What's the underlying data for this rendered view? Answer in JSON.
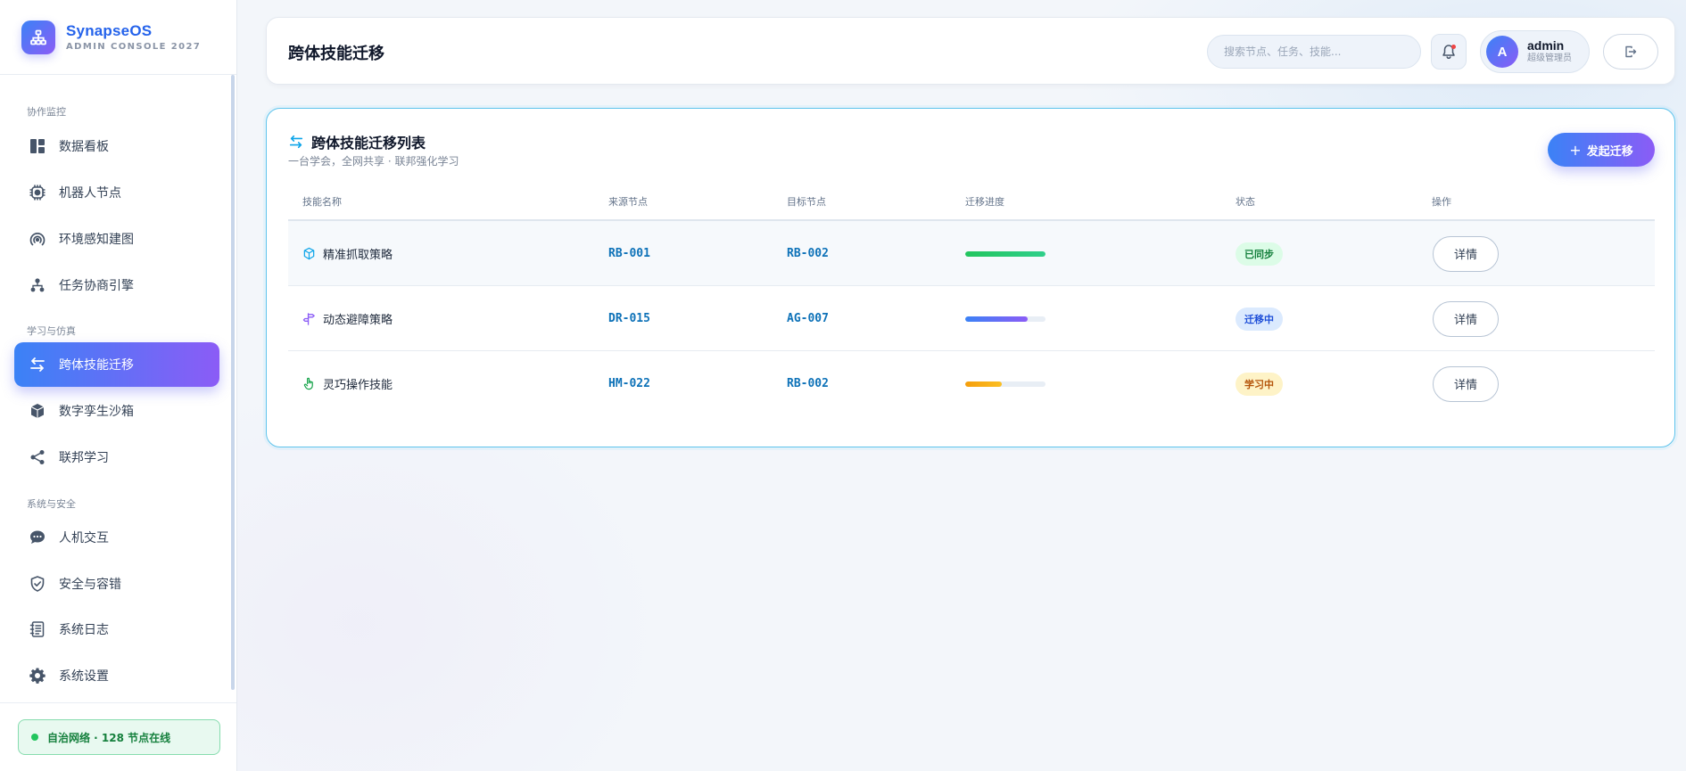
{
  "brand": {
    "name": "SynapseOS",
    "subtitle": "ADMIN CONSOLE 2027"
  },
  "sidebar": {
    "sections": [
      {
        "label": "协作监控"
      },
      {
        "label": "学习与仿真"
      },
      {
        "label": "系统与安全"
      }
    ],
    "items": [
      {
        "label": "数据看板",
        "icon": "dashboard-icon"
      },
      {
        "label": "机器人节点",
        "icon": "cpu-chip-icon"
      },
      {
        "label": "环境感知建图",
        "icon": "signal-arcs-icon"
      },
      {
        "label": "任务协商引擎",
        "icon": "hierarchy-icon"
      },
      {
        "label": "跨体技能迁移",
        "icon": "swap-arrows-icon",
        "active": true
      },
      {
        "label": "数字孪生沙箱",
        "icon": "cube-icon"
      },
      {
        "label": "联邦学习",
        "icon": "share-nodes-icon"
      },
      {
        "label": "人机交互",
        "icon": "chat-bubble-icon"
      },
      {
        "label": "安全与容错",
        "icon": "shield-check-icon"
      },
      {
        "label": "系统日志",
        "icon": "log-book-icon"
      },
      {
        "label": "系统设置",
        "icon": "gear-icon"
      }
    ],
    "footer": {
      "status": "自治网络 · 128 节点在线",
      "status_color": "#22c55e"
    }
  },
  "header": {
    "title": "跨体技能迁移",
    "search_placeholder": "搜索节点、任务、技能...",
    "user": {
      "initial": "A",
      "name": "admin",
      "role": "超级管理员"
    }
  },
  "card": {
    "title": "跨体技能迁移列表",
    "subtitle": "一台学会，全网共享 · 联邦强化学习",
    "action_label": "发起迁移",
    "columns": [
      "技能名称",
      "来源节点",
      "目标节点",
      "迁移进度",
      "状态",
      "操作"
    ],
    "rows": [
      {
        "skill": "精准抓取策略",
        "icon": "cube-outline-icon",
        "source": "RB-001",
        "target": "RB-002",
        "progress": 1.0,
        "progress_color": "#22c55e",
        "status": "已同步",
        "status_kind": "synced",
        "action": "详情"
      },
      {
        "skill": "动态避障策略",
        "icon": "signpost-icon",
        "source": "DR-015",
        "target": "AG-007",
        "progress": 0.78,
        "progress_color": "#6366f1",
        "status": "迁移中",
        "status_kind": "migrating",
        "action": "详情"
      },
      {
        "skill": "灵巧操作技能",
        "icon": "hand-pointer-icon",
        "source": "HM-022",
        "target": "RB-002",
        "progress": 0.45,
        "progress_color": "#f59e0b",
        "status": "学习中",
        "status_kind": "learning",
        "action": "详情"
      }
    ]
  },
  "colors": {
    "accent_start": "#3b82f6",
    "accent_end": "#8b5cf6",
    "node_text": "#0e72b8",
    "card_border": "#5ec3ec"
  }
}
